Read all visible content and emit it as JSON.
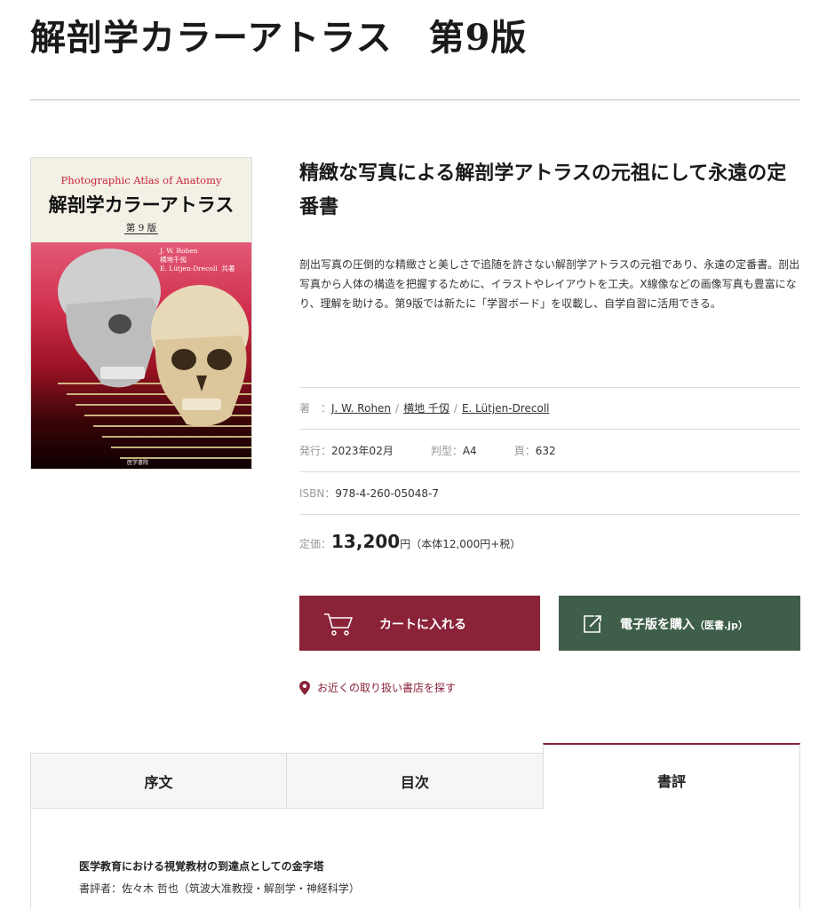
{
  "page_title": "解剖学カラーアトラス　第9版",
  "cover": {
    "title_en": "Photographic Atlas of Anatomy",
    "title_jp": "解剖学カラーアトラス",
    "edition": "第 9 版",
    "authors": [
      "J. W. Rohen",
      "横地千仭",
      "E. Lütjen-Drecoll"
    ],
    "authors_role": "共著",
    "publisher": "医学書院"
  },
  "catch_copy": "精緻な写真による解剖学アトラスの元祖にして永遠の定番書",
  "description": "剖出写真の圧倒的な精緻さと美しさで追随を許さない解剖学アトラスの元祖であり、永遠の定番書。剖出写真から人体の構造を把握するために、イラストやレイアウトを工夫。X線像などの画像写真も豊富になり、理解を助ける。第9版では新たに「学習ボード」を収載し、自学自習に活用できる。",
  "meta": {
    "authors_label": "著　：",
    "authors": [
      "J. W. Rohen",
      "横地 千仭",
      "E. Lütjen-Drecoll"
    ],
    "issued_label": "発行：",
    "issued": "2023年02月",
    "format_label": "判型：",
    "format": "A4",
    "pages_label": "頁：",
    "pages": "632",
    "isbn_label": "ISBN：",
    "isbn": "978-4-260-05048-7",
    "price_label": "定価：",
    "price": "13,200",
    "price_unit": "円",
    "price_note": "（本体12,000円+税）"
  },
  "buttons": {
    "cart": "カートに入れる",
    "ebook": "電子版を購入",
    "ebook_small": "（医書.jp）"
  },
  "store_link": "お近くの取り扱い書店を探す",
  "tabs": [
    "序文",
    "目次",
    "書評"
  ],
  "review": {
    "title": "医学教育における視覚教材の到達点としての金字塔",
    "author": "書評者：佐々木 哲也（筑波大准教授・解剖学・神経科学）"
  },
  "colors": {
    "accent": "#8a2238",
    "ebook_green": "#3e5e49"
  }
}
